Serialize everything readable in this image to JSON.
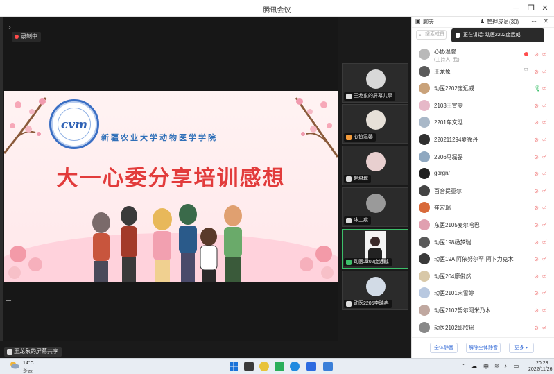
{
  "window": {
    "title": "腾讯会议"
  },
  "recording": {
    "label": "录制中"
  },
  "slide": {
    "logo_mark": "cvm",
    "school": "新疆农业大学动物医学学院",
    "headline": "大一心委分享培训感想"
  },
  "thumbnails": [
    {
      "label": "王龙象的屏幕共享",
      "avatar_color": "#d8d8d8"
    },
    {
      "label": "心协温馨",
      "avatar_color": "#e6e0d8"
    },
    {
      "label": "赵琳琼",
      "avatar_color": "#e8cfcf"
    },
    {
      "label": "冰上痕",
      "avatar_color": "#9a9a9a"
    },
    {
      "label": "动医2202庞远威",
      "avatar_color": "#f0f0f0"
    },
    {
      "label": "动医2205李瑞冉",
      "avatar_color": "#d2dbe6"
    }
  ],
  "share_tag": {
    "label": "王龙象的屏幕共享"
  },
  "sidebar": {
    "chat_tab": "聊天",
    "members_tab": "管理成员(30)",
    "more": "···",
    "search_placeholder": "搜索成员",
    "toast": "正在讲话: 动医2202庞远威",
    "members": [
      {
        "name": "心协温馨",
        "sub": "(主持人, 我)",
        "color": "#b9b9b9",
        "state": "rec"
      },
      {
        "name": "王龙象",
        "sub": "",
        "color": "#5b5b5b",
        "state": "shield"
      },
      {
        "name": "动医2202庞远威",
        "sub": "",
        "color": "#c9a27a",
        "state": "talk"
      },
      {
        "name": "2103王宣雯",
        "sub": "",
        "color": "#e6b8c8",
        "state": ""
      },
      {
        "name": "2201车文湉",
        "sub": "",
        "color": "#a9b8c8",
        "state": ""
      },
      {
        "name": "220211294夏徐丹",
        "sub": "",
        "color": "#303030",
        "state": ""
      },
      {
        "name": "2206马磊磊",
        "sub": "",
        "color": "#8fa8c0",
        "state": ""
      },
      {
        "name": "gdrgn/",
        "sub": "",
        "color": "#222222",
        "state": ""
      },
      {
        "name": "百合提亚尔",
        "sub": "",
        "color": "#444444",
        "state": ""
      },
      {
        "name": "崔宏瑞",
        "sub": "",
        "color": "#d86a3a",
        "state": ""
      },
      {
        "name": "东医2105麦尔哈巴",
        "sub": "",
        "color": "#e0a0b0",
        "state": ""
      },
      {
        "name": "动医198杨梦瑞",
        "sub": "",
        "color": "#5a5a5a",
        "state": ""
      },
      {
        "name": "动医19A 阿依努尔罕·阿卜力克木",
        "sub": "",
        "color": "#3a3a3a",
        "state": ""
      },
      {
        "name": "动医204廖俊然",
        "sub": "",
        "color": "#d8c8a8",
        "state": ""
      },
      {
        "name": "动医2101宋雪婷",
        "sub": "",
        "color": "#b8c8e0",
        "state": ""
      },
      {
        "name": "动医2102努尔阿米乃木",
        "sub": "",
        "color": "#c0a8a0",
        "state": ""
      },
      {
        "name": "动医2102邱欣瑶",
        "sub": "",
        "color": "#888888",
        "state": ""
      }
    ],
    "footer": {
      "mute_all": "全体静音",
      "unmute_all": "解除全体静音",
      "more": "更多 ▸"
    }
  },
  "taskbar": {
    "temp": "14°C",
    "weather": "多云",
    "ime": "中",
    "time": "20:23",
    "date": "2022/11/26"
  },
  "colors": {
    "accent": "#3a6fd8",
    "mic_off": "#f08080",
    "slide_title": "#e23b3b"
  }
}
